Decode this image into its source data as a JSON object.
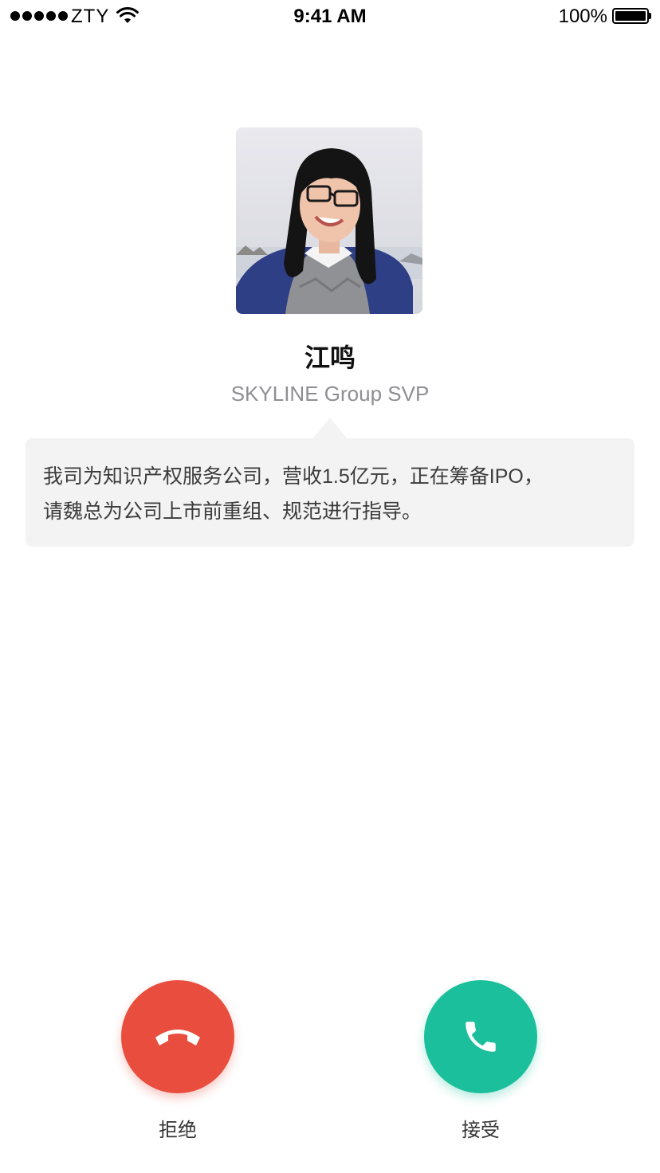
{
  "status_bar": {
    "carrier": "ZTY",
    "time": "9:41 AM",
    "battery": "100%",
    "signal_bars": 5,
    "battery_level": 1.0
  },
  "caller": {
    "name": "江鸣",
    "title": "SKYLINE Group SVP",
    "avatar_icon": "person-photo"
  },
  "message": {
    "line1": "我司为知识产权服务公司，营收1.5亿元，正在筹备IPO，",
    "line2": "请魏总为公司上市前重组、规范进行指导。"
  },
  "actions": {
    "decline_label": "拒绝",
    "accept_label": "接受",
    "decline_color": "#e84d3d",
    "accept_color": "#1bbf9c",
    "decline_icon": "hang-up-icon",
    "accept_icon": "phone-icon"
  }
}
